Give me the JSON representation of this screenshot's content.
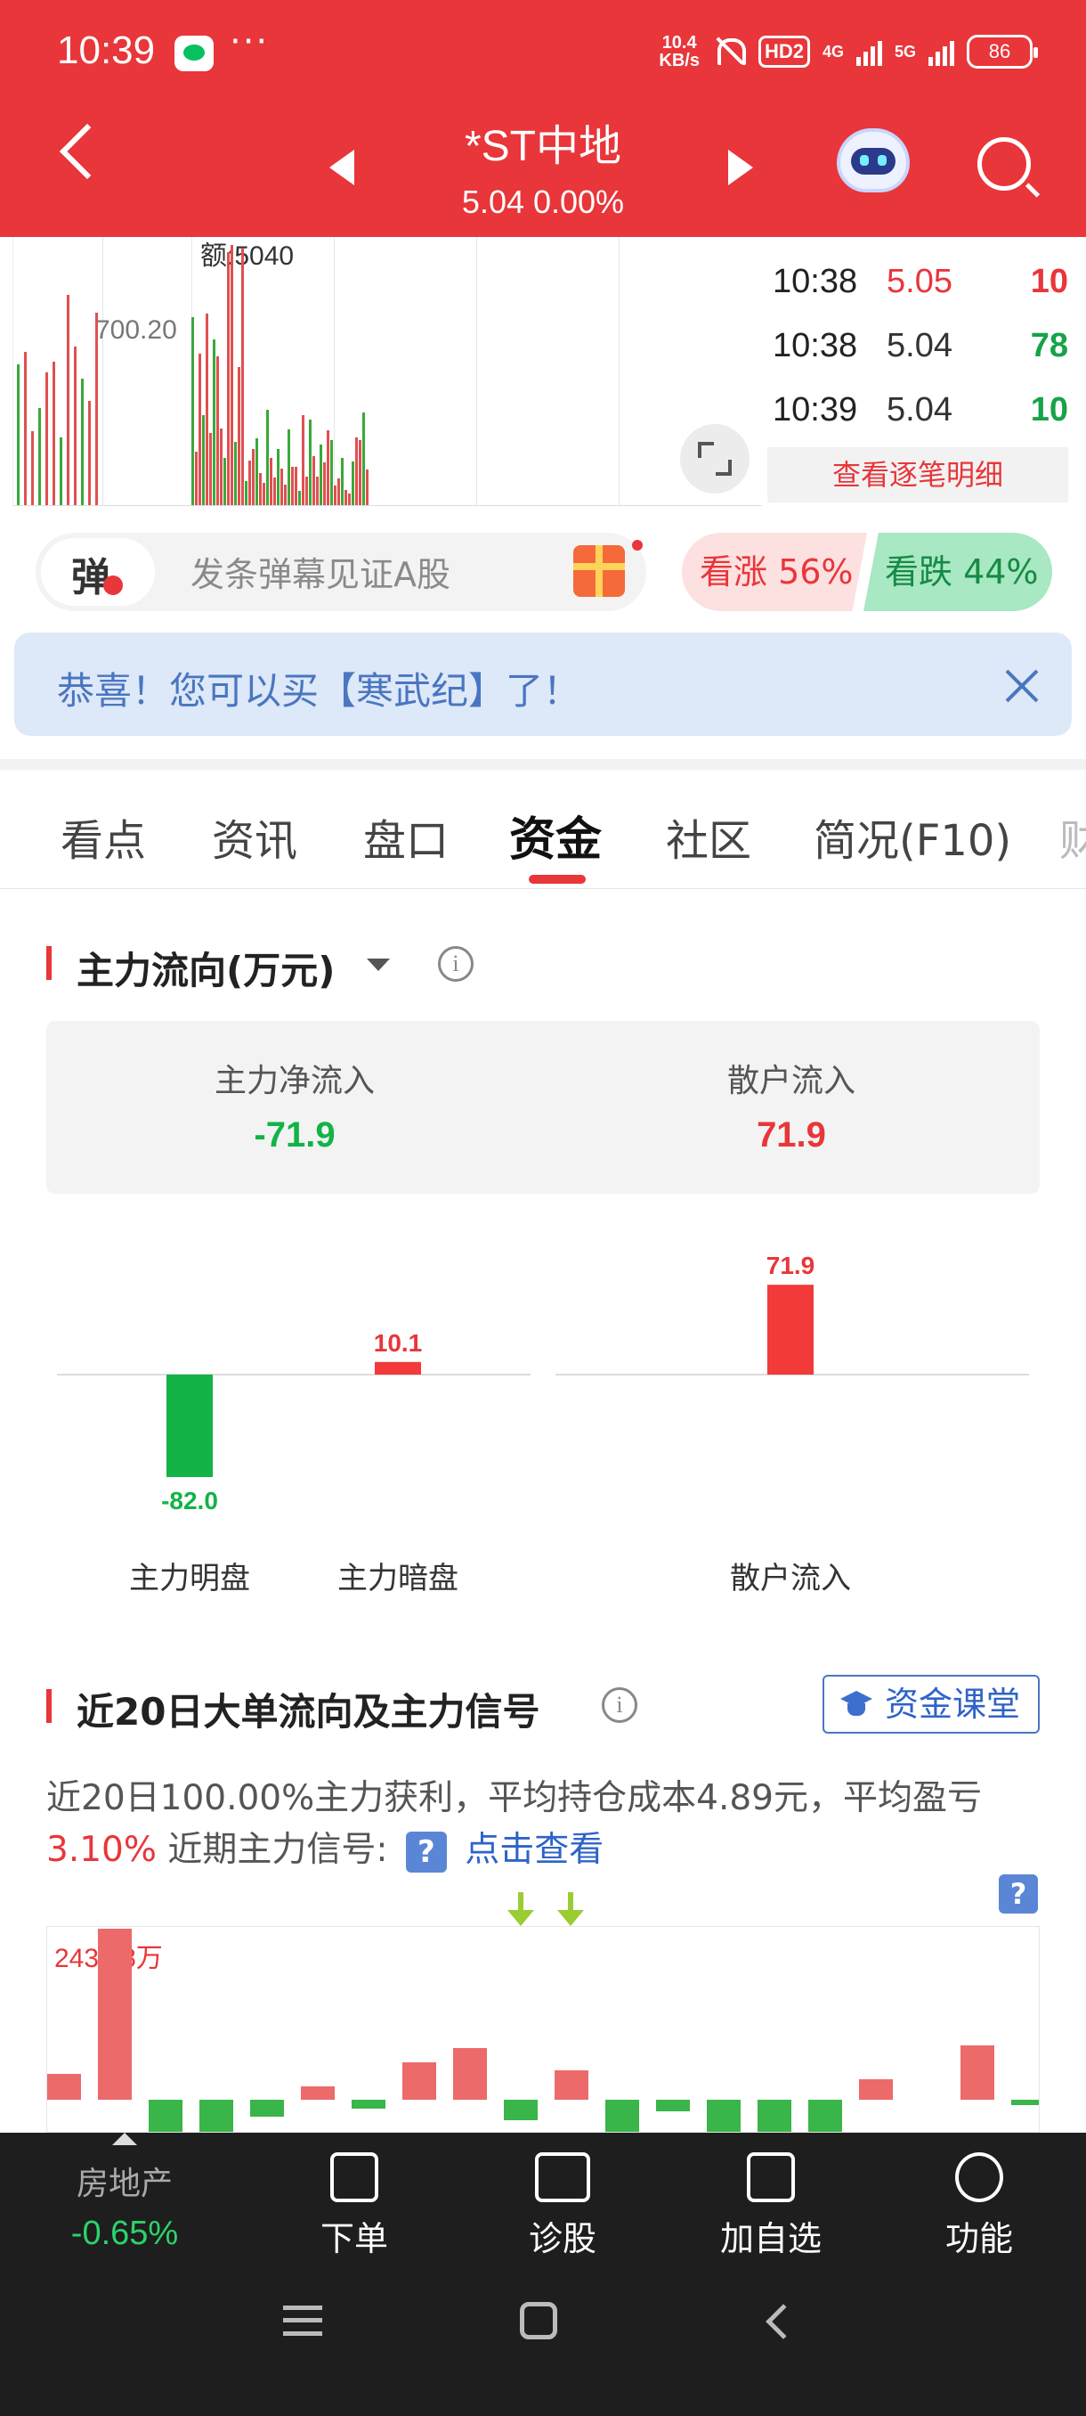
{
  "status_bar": {
    "time": "10:39",
    "net_speed_value": "10.4",
    "net_speed_unit": "KB/s",
    "hd_label": "HD2",
    "net_4g": "4G",
    "net_5g": "5G",
    "battery": "86"
  },
  "header": {
    "stock_name": "*ST中地",
    "price_line": "5.04 0.00%",
    "background_color": "#e8363a"
  },
  "mini_chart": {
    "volume_label": "额:5040",
    "level_label": "700.20"
  },
  "ticks": [
    {
      "time": "10:38",
      "price": "5.05",
      "volume": "10",
      "price_color": "#e8363a",
      "volume_color": "#e8363a"
    },
    {
      "time": "10:38",
      "price": "5.04",
      "volume": "78",
      "price_color": "#333333",
      "volume_color": "#16a34a"
    },
    {
      "time": "10:39",
      "price": "5.04",
      "volume": "10",
      "price_color": "#333333",
      "volume_color": "#16a34a"
    }
  ],
  "tick_more_label": "查看逐笔明细",
  "danmu": {
    "badge": "弹",
    "placeholder": "发条弹幕见证A股"
  },
  "sentiment": {
    "up_label": "看涨 56%",
    "down_label": "看跌 44%"
  },
  "notice": {
    "text": "恭喜！您可以买【寒武纪】了！"
  },
  "tabs": [
    "看点",
    "资讯",
    "盘口",
    "资金",
    "社区",
    "简况(F10)",
    "财"
  ],
  "active_tab": "资金",
  "main_flow": {
    "title": "主力流向(万元)",
    "net_inflow_label": "主力净流入",
    "net_inflow_value": "-71.9",
    "retail_inflow_label": "散户流入",
    "retail_inflow_value": "71.9"
  },
  "chart_data": {
    "type": "bar",
    "categories": [
      "主力明盘",
      "主力暗盘",
      "散户流入"
    ],
    "values": [
      -82.0,
      10.1,
      71.9
    ],
    "value_labels": [
      "-82.0",
      "10.1",
      "71.9"
    ],
    "colors": {
      "positive": "#f23a3a",
      "negative": "#12b347"
    }
  },
  "twenty_day": {
    "title": "近20日大单流向及主力信号",
    "course_button": "资金课堂",
    "desc_part1": "近20日100.00%主力获利，平均持仓成本4.89元，平均盈亏",
    "desc_red": "3.10%",
    "desc_part2": "近期主力信号:",
    "desc_link": "点击查看",
    "max_label": "2439.8万",
    "question_mark": "?"
  },
  "d20_chart_data": {
    "type": "bar",
    "values": [
      15,
      100,
      -20,
      -20,
      -10,
      8,
      -5,
      22,
      30,
      -12,
      17,
      -20,
      -7,
      -20,
      -20,
      -20,
      12,
      0,
      32,
      -3
    ]
  },
  "bottom_bar": {
    "sector_name": "房地产",
    "sector_change": "-0.65%",
    "items": [
      "下单",
      "诊股",
      "加自选",
      "功能"
    ]
  }
}
